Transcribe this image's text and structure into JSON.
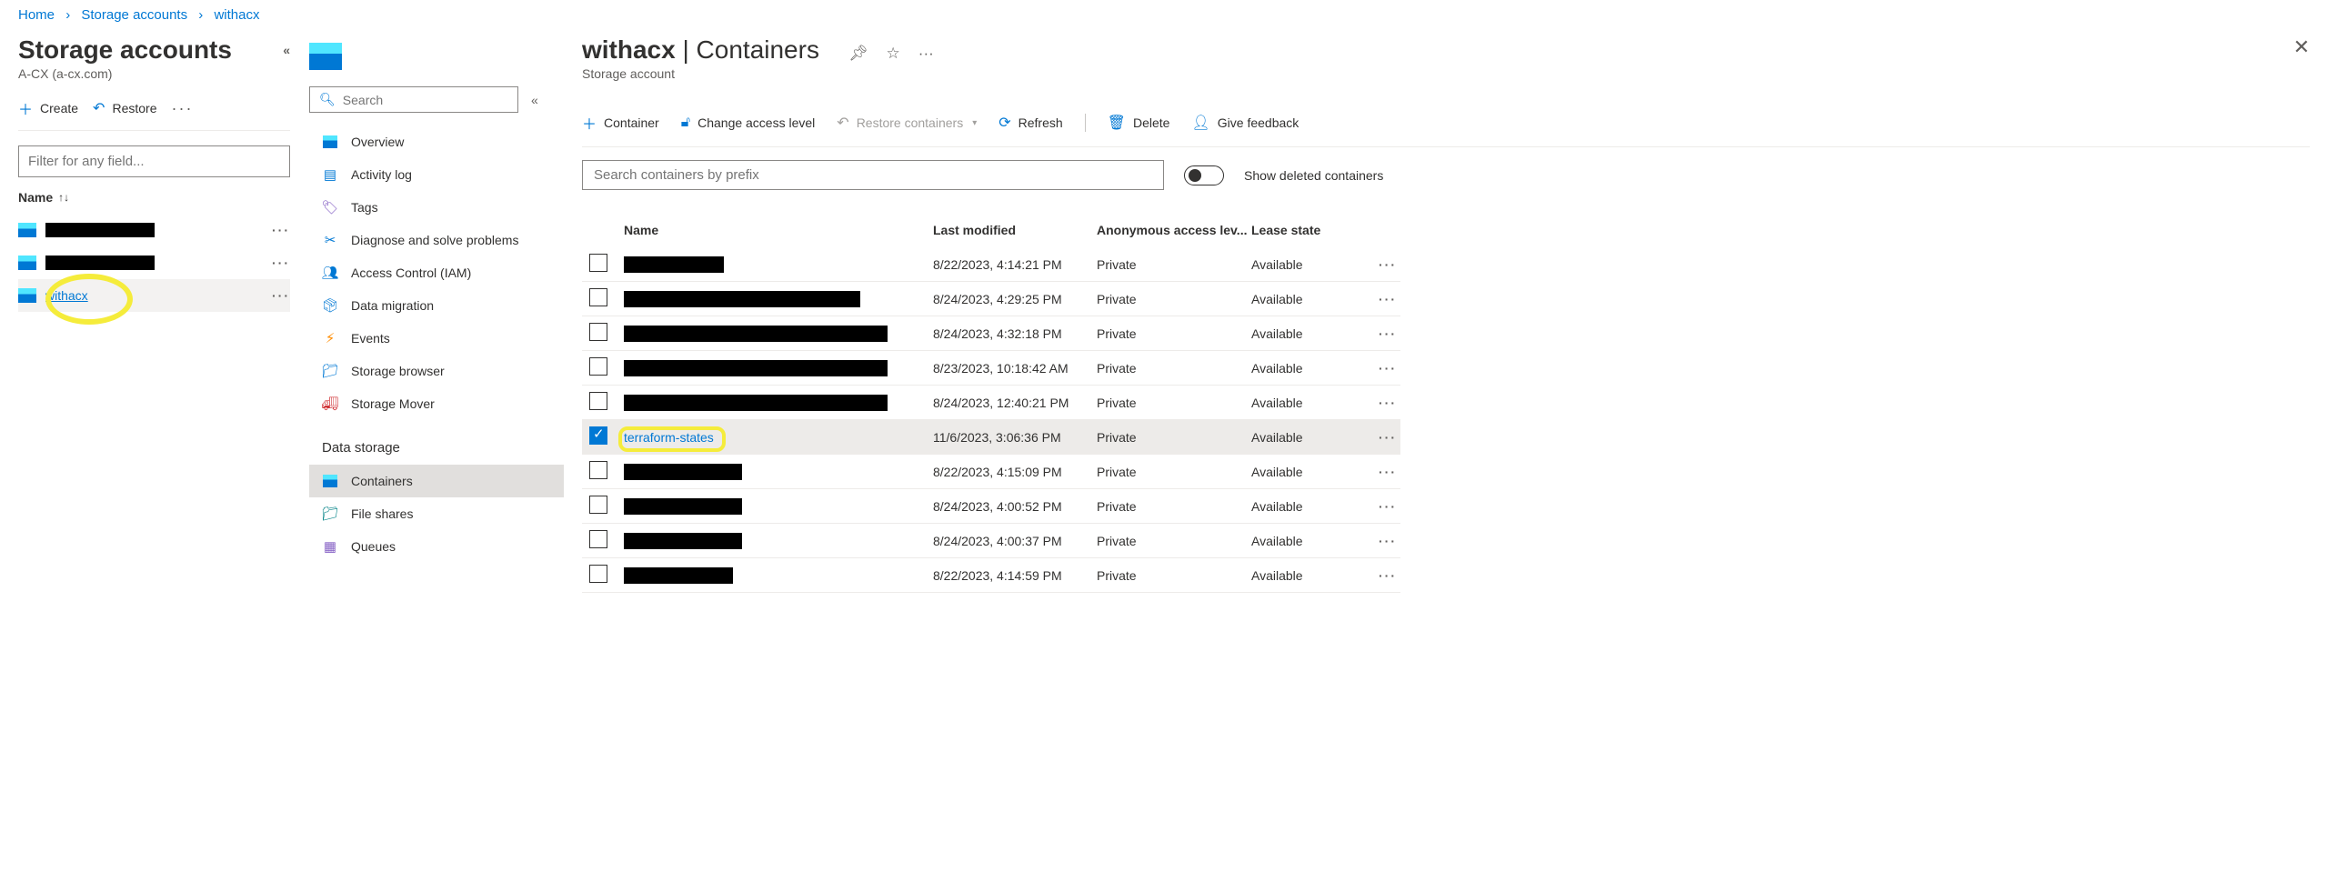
{
  "breadcrumb": [
    "Home",
    "Storage accounts",
    "withacx"
  ],
  "leftPanel": {
    "title": "Storage accounts",
    "subtitle": "A-CX (a-cx.com)",
    "createLabel": "Create",
    "restoreLabel": "Restore",
    "filterPlaceholder": "Filter for any field...",
    "nameHeader": "Name",
    "accounts": [
      {
        "name": "",
        "redacted": true,
        "selected": false
      },
      {
        "name": "",
        "redacted": true,
        "selected": false
      },
      {
        "name": "withacx",
        "redacted": false,
        "selected": true,
        "highlighted": true
      }
    ]
  },
  "midPanel": {
    "searchPlaceholder": "Search",
    "items1": [
      {
        "label": "Overview",
        "icon": "overview"
      },
      {
        "label": "Activity log",
        "icon": "activitylog"
      },
      {
        "label": "Tags",
        "icon": "tags"
      },
      {
        "label": "Diagnose and solve problems",
        "icon": "diagnose"
      },
      {
        "label": "Access Control (IAM)",
        "icon": "iam"
      },
      {
        "label": "Data migration",
        "icon": "migration"
      },
      {
        "label": "Events",
        "icon": "events"
      },
      {
        "label": "Storage browser",
        "icon": "browser"
      },
      {
        "label": "Storage Mover",
        "icon": "mover"
      }
    ],
    "section2": "Data storage",
    "items2": [
      {
        "label": "Containers",
        "icon": "containers",
        "selected": true
      },
      {
        "label": "File shares",
        "icon": "fileshares"
      },
      {
        "label": "Queues",
        "icon": "queues"
      }
    ]
  },
  "main": {
    "titleName": "withacx",
    "titleSuffix": "Containers",
    "subtitle": "Storage account",
    "cmd": {
      "container": "Container",
      "changeAccess": "Change access level",
      "restore": "Restore containers",
      "refresh": "Refresh",
      "delete": "Delete",
      "feedback": "Give feedback"
    },
    "searchPlaceholder": "Search containers by prefix",
    "toggleLabel": "Show deleted containers",
    "columns": {
      "name": "Name",
      "modified": "Last modified",
      "access": "Anonymous access lev...",
      "lease": "Lease state"
    },
    "rows": [
      {
        "name": "",
        "redacted": true,
        "redactW": 110,
        "modified": "8/22/2023, 4:14:21 PM",
        "access": "Private",
        "lease": "Available",
        "selected": false
      },
      {
        "name": "",
        "redacted": true,
        "redactW": 260,
        "modified": "8/24/2023, 4:29:25 PM",
        "access": "Private",
        "lease": "Available",
        "selected": false
      },
      {
        "name": "",
        "redacted": true,
        "redactW": 290,
        "modified": "8/24/2023, 4:32:18 PM",
        "access": "Private",
        "lease": "Available",
        "selected": false
      },
      {
        "name": "",
        "redacted": true,
        "redactW": 290,
        "modified": "8/23/2023, 10:18:42 AM",
        "access": "Private",
        "lease": "Available",
        "selected": false
      },
      {
        "name": "",
        "redacted": true,
        "redactW": 290,
        "modified": "8/24/2023, 12:40:21 PM",
        "access": "Private",
        "lease": "Available",
        "selected": false
      },
      {
        "name": "terraform-states",
        "redacted": false,
        "highlighted": true,
        "modified": "11/6/2023, 3:06:36 PM",
        "access": "Private",
        "lease": "Available",
        "selected": true
      },
      {
        "name": "",
        "redacted": true,
        "redactW": 130,
        "modified": "8/22/2023, 4:15:09 PM",
        "access": "Private",
        "lease": "Available",
        "selected": false
      },
      {
        "name": "",
        "redacted": true,
        "redactW": 130,
        "modified": "8/24/2023, 4:00:52 PM",
        "access": "Private",
        "lease": "Available",
        "selected": false
      },
      {
        "name": "",
        "redacted": true,
        "redactW": 130,
        "modified": "8/24/2023, 4:00:37 PM",
        "access": "Private",
        "lease": "Available",
        "selected": false
      },
      {
        "name": "",
        "redacted": true,
        "redactW": 120,
        "modified": "8/22/2023, 4:14:59 PM",
        "access": "Private",
        "lease": "Available",
        "selected": false
      }
    ]
  }
}
